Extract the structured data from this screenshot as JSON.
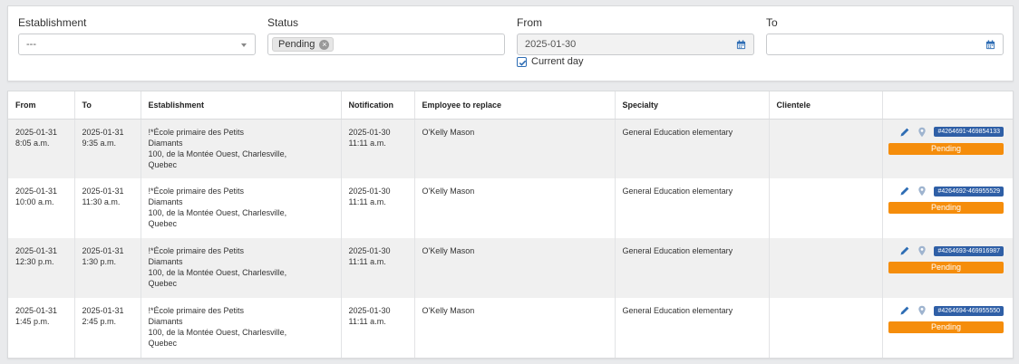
{
  "filters": {
    "establishment": {
      "label": "Establishment",
      "value": "---"
    },
    "status": {
      "label": "Status",
      "tag": "Pending"
    },
    "from": {
      "label": "From",
      "value": "2025-01-30",
      "current_day_label": "Current day",
      "current_day_checked": true
    },
    "to": {
      "label": "To",
      "value": ""
    }
  },
  "table": {
    "headers": [
      "From",
      "To",
      "Establishment",
      "Notification",
      "Employee to replace",
      "Specialty",
      "Clientele",
      ""
    ],
    "rows": [
      {
        "from_date": "2025-01-31",
        "from_time": "8:05 a.m.",
        "to_date": "2025-01-31",
        "to_time": "9:35 a.m.",
        "estab_name_1": "!*École primaire des Petits",
        "estab_name_2": "Diamants",
        "estab_addr_1": "100, de la Montée Ouest, Charlesville,",
        "estab_addr_2": "Quebec",
        "notif_date": "2025-01-30",
        "notif_time": "11:11 a.m.",
        "employee": "O'Kelly Mason",
        "specialty": "General Education elementary",
        "clientele": "",
        "id": "#4264691-469854133",
        "status": "Pending"
      },
      {
        "from_date": "2025-01-31",
        "from_time": "10:00 a.m.",
        "to_date": "2025-01-31",
        "to_time": "11:30 a.m.",
        "estab_name_1": "!*École primaire des Petits",
        "estab_name_2": "Diamants",
        "estab_addr_1": "100, de la Montée Ouest, Charlesville,",
        "estab_addr_2": "Quebec",
        "notif_date": "2025-01-30",
        "notif_time": "11:11 a.m.",
        "employee": "O'Kelly Mason",
        "specialty": "General Education elementary",
        "clientele": "",
        "id": "#4264692-469955529",
        "status": "Pending"
      },
      {
        "from_date": "2025-01-31",
        "from_time": "12:30 p.m.",
        "to_date": "2025-01-31",
        "to_time": "1:30 p.m.",
        "estab_name_1": "!*École primaire des Petits",
        "estab_name_2": "Diamants",
        "estab_addr_1": "100, de la Montée Ouest, Charlesville,",
        "estab_addr_2": "Quebec",
        "notif_date": "2025-01-30",
        "notif_time": "11:11 a.m.",
        "employee": "O'Kelly Mason",
        "specialty": "General Education elementary",
        "clientele": "",
        "id": "#4264693-469916987",
        "status": "Pending"
      },
      {
        "from_date": "2025-01-31",
        "from_time": "1:45 p.m.",
        "to_date": "2025-01-31",
        "to_time": "2:45 p.m.",
        "estab_name_1": "!*École primaire des Petits",
        "estab_name_2": "Diamants",
        "estab_addr_1": "100, de la Montée Ouest, Charlesville,",
        "estab_addr_2": "Quebec",
        "notif_date": "2025-01-30",
        "notif_time": "11:11 a.m.",
        "employee": "O'Kelly Mason",
        "specialty": "General Education elementary",
        "clientele": "",
        "id": "#4264694-469955550",
        "status": "Pending"
      }
    ]
  },
  "colors": {
    "status_pending": "#f58d0b",
    "id_badge": "#2f5fa6",
    "icon_blue": "#2e6db4"
  },
  "icons": {
    "select_caret": "chevron-down-icon",
    "calendar": "calendar-icon",
    "edit": "pencil-icon",
    "location": "map-pin-icon",
    "tag_remove": "close-icon",
    "checkbox": "check-icon"
  }
}
